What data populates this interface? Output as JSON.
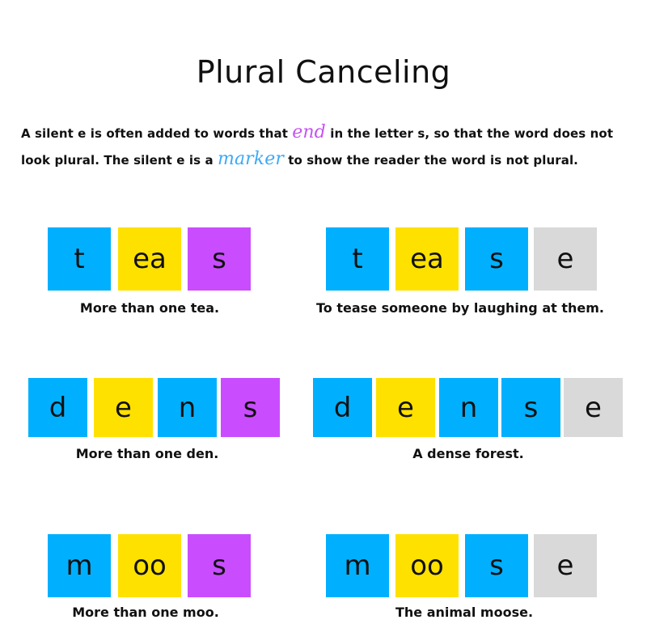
{
  "title": "Plural Canceling",
  "intro": {
    "line1_before": "A silent e is often added to words that ",
    "line1_highlight": "end",
    "line1_after": " in the letter s, so that the word does not",
    "line2_before": "look plural. The silent e is a ",
    "line2_highlight": "marker",
    "line2_after": " to show the reader the word is not plural."
  },
  "colors": {
    "blue": "#00b0ff",
    "yellow": "#ffe100",
    "purple": "#c94dff",
    "gray": "#d9d9d9",
    "end_highlight": "#c653f2",
    "marker_highlight": "#3fa9f5"
  },
  "examples": [
    {
      "tiles": [
        {
          "text": "t",
          "color": "blue"
        },
        {
          "text": "ea",
          "color": "yellow"
        },
        {
          "text": "s",
          "color": "purple"
        }
      ],
      "caption": "More than one tea."
    },
    {
      "tiles": [
        {
          "text": "t",
          "color": "blue"
        },
        {
          "text": "ea",
          "color": "yellow"
        },
        {
          "text": "s",
          "color": "blue"
        },
        {
          "text": "e",
          "color": "gray"
        }
      ],
      "caption": "To tease someone by laughing at them."
    },
    {
      "tiles": [
        {
          "text": "d",
          "color": "blue"
        },
        {
          "text": "e",
          "color": "yellow"
        },
        {
          "text": "n",
          "color": "blue"
        },
        {
          "text": "s",
          "color": "purple"
        }
      ],
      "caption": "More than one den."
    },
    {
      "tiles": [
        {
          "text": "d",
          "color": "blue"
        },
        {
          "text": "e",
          "color": "yellow"
        },
        {
          "text": "n",
          "color": "blue"
        },
        {
          "text": "s",
          "color": "blue"
        },
        {
          "text": "e",
          "color": "gray"
        }
      ],
      "caption": "A dense forest."
    },
    {
      "tiles": [
        {
          "text": "m",
          "color": "blue"
        },
        {
          "text": "oo",
          "color": "yellow"
        },
        {
          "text": "s",
          "color": "purple"
        }
      ],
      "caption": "More than one moo."
    },
    {
      "tiles": [
        {
          "text": "m",
          "color": "blue"
        },
        {
          "text": "oo",
          "color": "yellow"
        },
        {
          "text": "s",
          "color": "blue"
        },
        {
          "text": "e",
          "color": "gray"
        }
      ],
      "caption": "The animal moose."
    }
  ]
}
